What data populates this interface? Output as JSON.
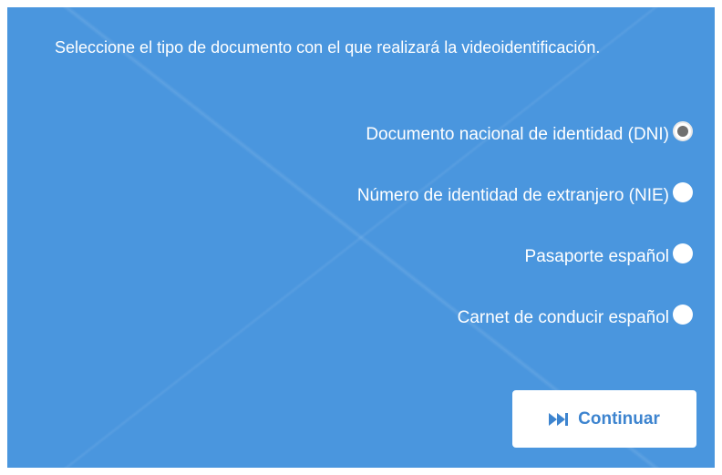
{
  "instruction": "Seleccione el tipo de documento con el que realizará la videoidentificación.",
  "options": [
    {
      "label": "Documento nacional de identidad (DNI)",
      "selected": true
    },
    {
      "label": "Número de identidad de extranjero (NIE)",
      "selected": false
    },
    {
      "label": "Pasaporte español",
      "selected": false
    },
    {
      "label": "Carnet de conducir español",
      "selected": false
    }
  ],
  "continue_button": {
    "label": "Continuar",
    "icon": "fast-forward-icon"
  },
  "colors": {
    "panel_background": "#4a96de",
    "button_text": "#3d84cf",
    "radio_selected_dot": "#6f6f6f"
  }
}
